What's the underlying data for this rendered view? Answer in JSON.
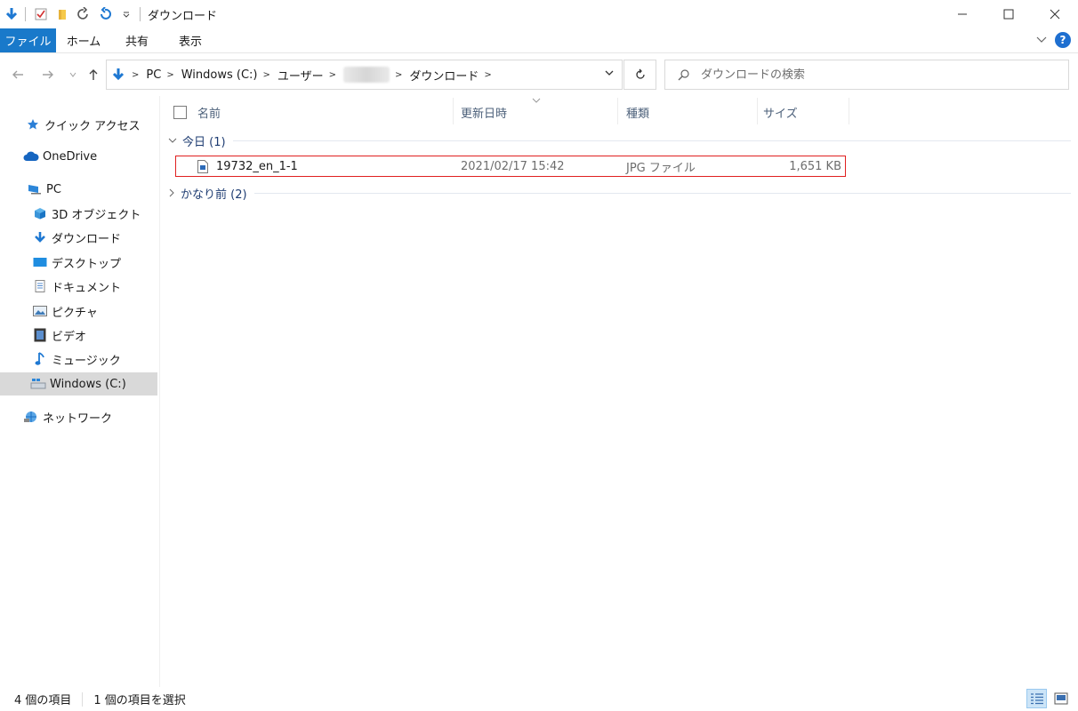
{
  "window": {
    "title": "ダウンロード"
  },
  "ribbon": {
    "tabs": [
      {
        "label": "ファイル"
      },
      {
        "label": "ホーム"
      },
      {
        "label": "共有"
      },
      {
        "label": "表示"
      }
    ],
    "help_label": "?"
  },
  "address": {
    "segments": [
      "PC",
      "Windows (C:)",
      "ユーザー",
      "ダウンロード"
    ]
  },
  "search": {
    "placeholder": "ダウンロードの検索"
  },
  "sidebar": {
    "items": [
      {
        "label": "クイック アクセス",
        "icon": "star-icon"
      },
      {
        "label": "OneDrive",
        "icon": "cloud-icon"
      },
      {
        "label": "PC",
        "icon": "computer-icon"
      },
      {
        "label": "3D オブジェクト",
        "icon": "cube-icon"
      },
      {
        "label": "ダウンロード",
        "icon": "download-arrow-icon"
      },
      {
        "label": "デスクトップ",
        "icon": "desktop-icon"
      },
      {
        "label": "ドキュメント",
        "icon": "document-icon"
      },
      {
        "label": "ピクチャ",
        "icon": "picture-icon"
      },
      {
        "label": "ビデオ",
        "icon": "video-icon"
      },
      {
        "label": "ミュージック",
        "icon": "music-note-icon"
      },
      {
        "label": "Windows (C:)",
        "icon": "drive-icon"
      },
      {
        "label": "ネットワーク",
        "icon": "network-icon"
      }
    ]
  },
  "columns": {
    "name": "名前",
    "date": "更新日時",
    "type": "種類",
    "size": "サイズ"
  },
  "groups": {
    "today": "今日 (1)",
    "earlier": "かなり前 (2)"
  },
  "files": [
    {
      "name": "19732_en_1-1",
      "date": "2021/02/17 15:42",
      "type": "JPG ファイル",
      "size": "1,651 KB"
    }
  ],
  "status": {
    "count": "4 個の項目",
    "selected": "1 個の項目を選択"
  },
  "colors": {
    "accent": "#1979ca",
    "highlight_border": "#e02020",
    "group_text": "#1e3c72"
  }
}
